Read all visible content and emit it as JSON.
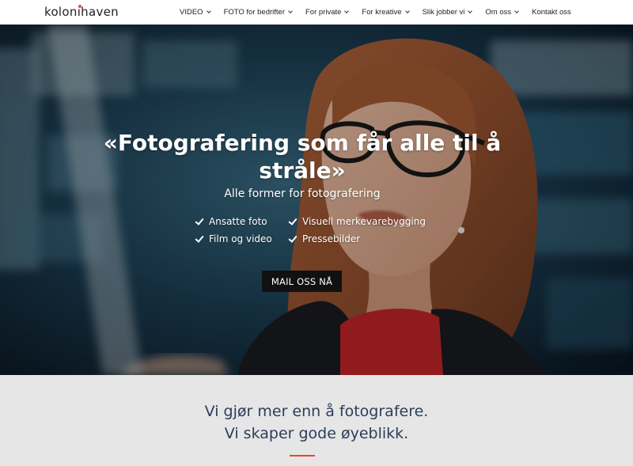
{
  "header": {
    "logo_text": "kolonihaven",
    "nav": [
      {
        "label": "VIDEO",
        "has_dropdown": true
      },
      {
        "label": "FOTO for bedrifter",
        "has_dropdown": true
      },
      {
        "label": "For private",
        "has_dropdown": true
      },
      {
        "label": "For kreative",
        "has_dropdown": true
      },
      {
        "label": "Slik jobber vi",
        "has_dropdown": true
      },
      {
        "label": "Om oss",
        "has_dropdown": true
      },
      {
        "label": "Kontakt oss",
        "has_dropdown": false
      }
    ]
  },
  "hero": {
    "title": "«Fotografering som får alle til å stråle»",
    "subtitle": "Alle former for fotografering",
    "features": [
      "Ansatte foto",
      "Visuell merkevarebygging",
      "Film og video",
      "Pressebilder"
    ],
    "cta_label": "MAIL OSS NÅ",
    "image_icon": "woman-portrait-photo"
  },
  "intro": {
    "line1": "Vi gjør mer enn å fotografere.",
    "line2": "Vi skaper gode øyeblikk."
  },
  "colors": {
    "accent": "#e8472b",
    "intro_text": "#2c3e5a",
    "intro_bg": "#e6e6e6",
    "cta_bg": "#111111"
  }
}
